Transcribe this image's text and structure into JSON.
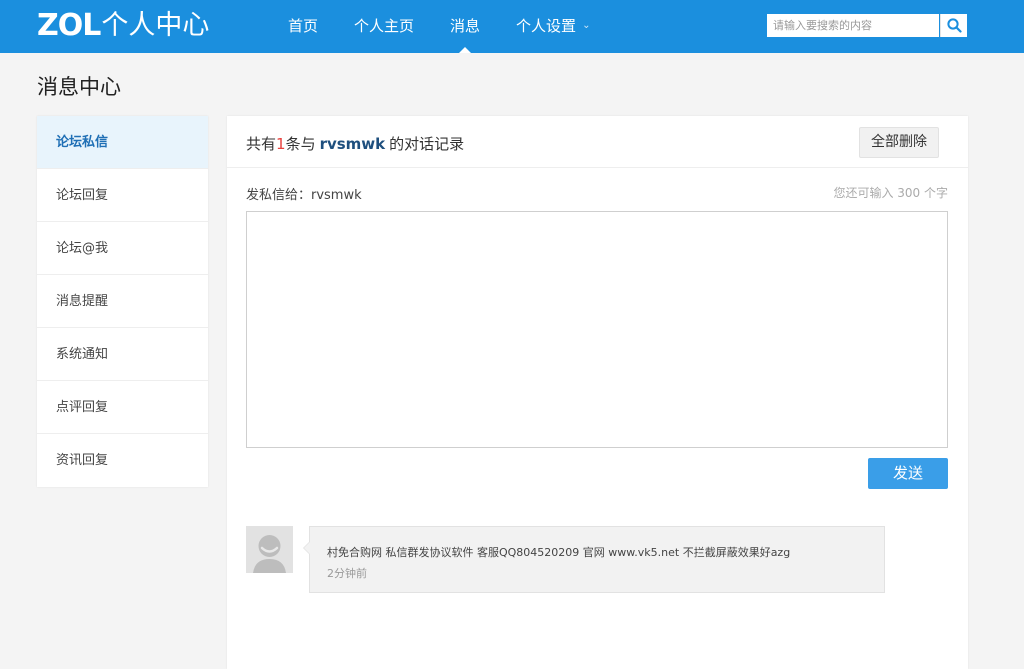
{
  "header": {
    "logo_mark": "ZOL",
    "logo_text": "个人中心",
    "nav": [
      {
        "label": "首页"
      },
      {
        "label": "个人主页"
      },
      {
        "label": "消息"
      },
      {
        "label": "个人设置"
      }
    ],
    "active_nav": "消息",
    "search_placeholder": "请输入要搜索的内容",
    "brand_color": "#1b8fde"
  },
  "page": {
    "title": "消息中心"
  },
  "sidebar": {
    "items": [
      {
        "label": "论坛私信"
      },
      {
        "label": "论坛回复"
      },
      {
        "label": "论坛@我"
      },
      {
        "label": "消息提醒"
      },
      {
        "label": "系统通知"
      },
      {
        "label": "点评回复"
      },
      {
        "label": "资讯回复"
      }
    ],
    "active": "论坛私信"
  },
  "conversation": {
    "summary_prefix": "共有",
    "count": "1",
    "summary_mid": "条与",
    "username": "rvsmwk",
    "summary_suffix": "的对话记录",
    "delete_all_label": "全部删除"
  },
  "compose": {
    "label": "发私信给：rvsmwk",
    "remaining_text": "您还可输入 300 个字",
    "value": "",
    "send_label": "发送",
    "send_color": "#3a9ee8"
  },
  "messages": [
    {
      "text": "村免合购网 私信群发协议软件 客服QQ804520209 官网 www.vk5.net 不拦截屏蔽效果好azg",
      "time": "2分钟前"
    }
  ],
  "icons": {
    "search": "search-icon",
    "nav_dropdown": "chevron-down-icon",
    "avatar": "default-avatar-icon"
  }
}
